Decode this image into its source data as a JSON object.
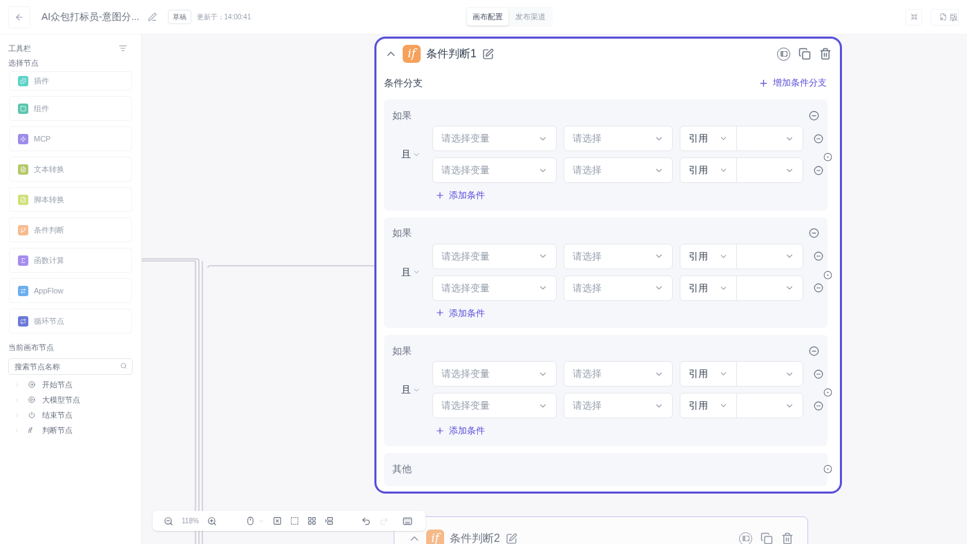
{
  "header": {
    "title": "AI众包打标员-意图分...",
    "status_badge": "草稿",
    "updated": "更新于：14:00:41",
    "tabs": [
      {
        "label": "画布配置",
        "selected": true
      },
      {
        "label": "发布渠道",
        "selected": false
      }
    ],
    "right_button": "版"
  },
  "sidebar": {
    "title": "工具栏",
    "section_nodes": "选择节点",
    "node_types": [
      {
        "label": "插件",
        "color": "#5fd3c8",
        "kind": "plugin"
      },
      {
        "label": "组件",
        "color": "#5cc6ae",
        "kind": "component"
      },
      {
        "label": "MCP",
        "color": "#9d8ceb",
        "kind": "bolt"
      },
      {
        "label": "文本转换",
        "color": "#b3c86a",
        "kind": "text"
      },
      {
        "label": "脚本转换",
        "color": "#cfe07a",
        "kind": "script"
      },
      {
        "label": "条件判断",
        "color": "#f7bb8f",
        "kind": "condition"
      },
      {
        "label": "函数计算",
        "color": "#a48cf0",
        "kind": "function"
      },
      {
        "label": "AppFlow",
        "color": "#6caff0",
        "kind": "flow"
      },
      {
        "label": "循环节点",
        "color": "#6b78d8",
        "kind": "loop"
      }
    ],
    "section_canvas": "当前画布节点",
    "search": {
      "placeholder": "搜索节点名称"
    },
    "tree": [
      {
        "label": "开始节点",
        "kind": "start",
        "expanded": false
      },
      {
        "label": "大模型节点",
        "kind": "model",
        "expanded": false
      },
      {
        "label": "结束节点",
        "kind": "end",
        "expanded": false
      },
      {
        "label": "判断节点",
        "kind": "condition",
        "icon_text": "if",
        "expanded": false
      }
    ]
  },
  "toolbar": {
    "zoom": "118%",
    "redo_disabled": true
  },
  "nodes": [
    {
      "icon_text": "if",
      "title": "条件判断1",
      "selected": true,
      "section": "条件分支",
      "add_branch": "增加条件分支",
      "branches": [
        {
          "label": "如果",
          "logic": "且",
          "add_condition": "添加条件",
          "conditions": [
            {
              "variable": {
                "placeholder": "请选择变量"
              },
              "operator": {
                "placeholder": "请选择"
              },
              "type": "引用"
            },
            {
              "variable": {
                "placeholder": "请选择变量"
              },
              "operator": {
                "placeholder": "请选择"
              },
              "type": "引用"
            }
          ]
        },
        {
          "label": "如果",
          "logic": "且",
          "add_condition": "添加条件",
          "conditions": [
            {
              "variable": {
                "placeholder": "请选择变量"
              },
              "operator": {
                "placeholder": "请选择"
              },
              "type": "引用"
            },
            {
              "variable": {
                "placeholder": "请选择变量"
              },
              "operator": {
                "placeholder": "请选择"
              },
              "type": "引用"
            }
          ]
        },
        {
          "label": "如果",
          "logic": "且",
          "add_condition": "添加条件",
          "conditions": [
            {
              "variable": {
                "placeholder": "请选择变量"
              },
              "operator": {
                "placeholder": "请选择"
              },
              "type": "引用"
            },
            {
              "variable": {
                "placeholder": "请选择变量"
              },
              "operator": {
                "placeholder": "请选择"
              },
              "type": "引用"
            }
          ]
        }
      ],
      "else": "其他"
    },
    {
      "icon_text": "if",
      "title": "条件判断2",
      "selected": false
    }
  ]
}
